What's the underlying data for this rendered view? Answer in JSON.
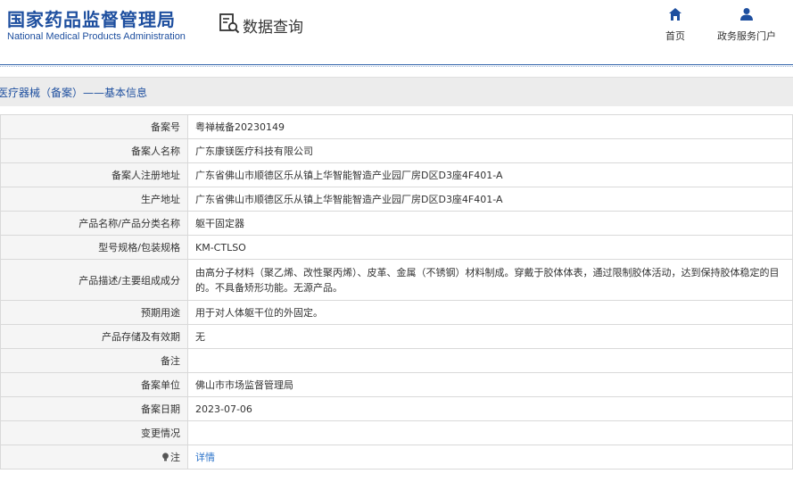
{
  "header": {
    "logo_cn": "国家药品监督管理局",
    "logo_en": "National Medical Products Administration",
    "query_label": "数据查询",
    "nav": [
      {
        "label": "首页",
        "icon": "home-icon"
      },
      {
        "label": "政务服务门户",
        "icon": "user-icon"
      }
    ],
    "accent_color": "#1e4f9f"
  },
  "section": {
    "title": "医疗器械（备案）——基本信息"
  },
  "rows": [
    {
      "key": "备案号",
      "value": "粤禅械备20230149"
    },
    {
      "key": "备案人名称",
      "value": "广东康镁医疗科技有限公司"
    },
    {
      "key": "备案人注册地址",
      "value": "广东省佛山市顺德区乐从镇上华智能智造产业园厂房D区D3座4F401-A"
    },
    {
      "key": "生产地址",
      "value": "广东省佛山市顺德区乐从镇上华智能智造产业园厂房D区D3座4F401-A"
    },
    {
      "key": "产品名称/产品分类名称",
      "value": "躯干固定器"
    },
    {
      "key": "型号规格/包装规格",
      "value": "KM-CTLSO"
    },
    {
      "key": "产品描述/主要组成成分",
      "value": "由高分子材料（聚乙烯、改性聚丙烯）、皮革、金属（不锈钢）材料制成。穿戴于胶体体表，通过限制胶体活动，达到保持胶体稳定的目的。不具备矫形功能。无源产品。"
    },
    {
      "key": "预期用途",
      "value": "用于对人体躯干位的外固定。"
    },
    {
      "key": "产品存储及有效期",
      "value": "无"
    },
    {
      "key": "备注",
      "value": ""
    },
    {
      "key": "备案单位",
      "value": "佛山市市场监督管理局"
    },
    {
      "key": "备案日期",
      "value": "2023-07-06"
    },
    {
      "key": "变更情况",
      "value": ""
    },
    {
      "key": "注",
      "value": "详情",
      "icon": "lightbulb-icon"
    }
  ]
}
